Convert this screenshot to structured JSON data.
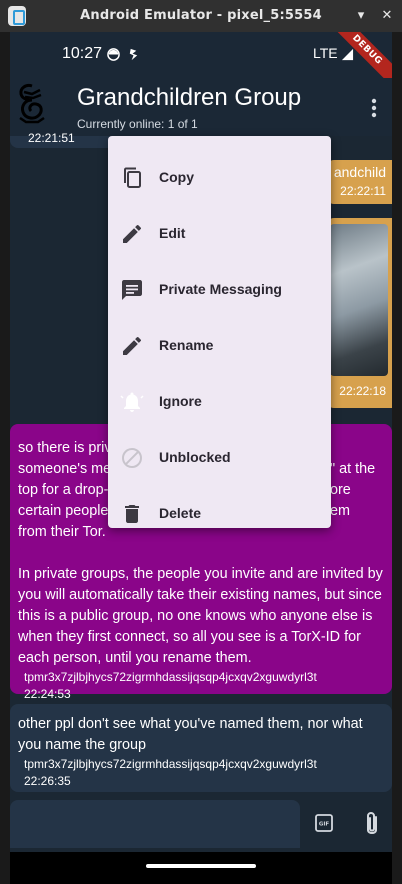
{
  "emulator": {
    "title": "Android Emulator - pixel_5:5554"
  },
  "status_bar": {
    "time": "10:27",
    "network": "LTE"
  },
  "debug_banner": "DEBUG",
  "app_bar": {
    "title": "Grandchildren Group",
    "subtitle": "Currently online: 1 of 1"
  },
  "messages": {
    "top_partial": {
      "time": "22:21:51"
    },
    "orange_1": {
      "sender_partial": "andchild",
      "time": "22:22:11"
    },
    "orange_2": {
      "time": "22:22:18"
    },
    "purple": {
      "text_visible": "so there is priv\nsomeone's me\ntop for a drop-\ncertain people\nfrom their Tor.",
      "text_visible_right": "n\ne\" at the\nnore\nhem",
      "text_2": "In private groups, the people you invite and are invited by you will automatically take their existing names, but since this is a public group, no one knows who anyone else is when they first connect, so all you see is a TorX-ID for each person, until you rename them.",
      "sender_id": "tpmr3x7zjlbjhycs72zigrmhdassijqsqp4jcxqv2xguwdyrl3t",
      "time": "22:24:53"
    },
    "dark": {
      "text": "other ppl don't see what you've named them, nor what you name the group",
      "sender_id": "tpmr3x7zjlbjhycs72zigrmhdassijqsqp4jcxqv2xguwdyrl3t",
      "time": "22:26:35"
    }
  },
  "context_menu": {
    "items": [
      {
        "label": "Copy",
        "icon": "copy-icon"
      },
      {
        "label": "Edit",
        "icon": "pencil-icon"
      },
      {
        "label": "Private Messaging",
        "icon": "message-icon"
      },
      {
        "label": "Rename",
        "icon": "pencil-icon"
      },
      {
        "label": "Ignore",
        "icon": "bell-icon"
      },
      {
        "label": "Unblocked",
        "icon": "block-icon"
      },
      {
        "label": "Delete",
        "icon": "trash-icon"
      }
    ]
  },
  "input": {
    "placeholder": ""
  },
  "colors": {
    "background": "#1b2733",
    "incoming_bubble": "#243447",
    "outgoing_bubble": "#d7a14d",
    "purple_bubble": "#8a0589",
    "menu_background": "#efe8f3"
  }
}
